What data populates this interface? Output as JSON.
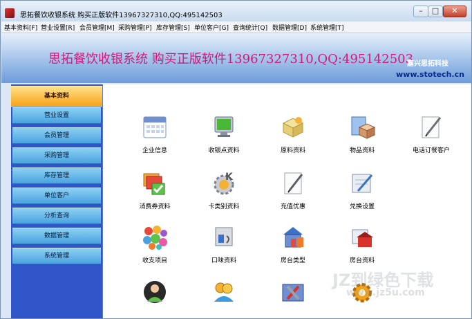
{
  "window": {
    "title": "思拓餐饮收银系统  购买正版软件13967327310,QQ:495142503",
    "minimize": "–",
    "maximize": "□",
    "close": "✕"
  },
  "menu": [
    "基本资料[F]",
    "营业设置[R]",
    "会员管理[M]",
    "采购管理[P]",
    "库存管理[S]",
    "单位客户[G]",
    "查询统计[Q]",
    "数据管理[D]",
    "系统管理[T]"
  ],
  "banner": {
    "headline": "思拓餐饮收银系统   购买正版软件13967327310,QQ:495142503",
    "brand": "嘉兴思拓科技",
    "url": "www.stotech.cn"
  },
  "sidebar": {
    "items": [
      "基本资料",
      "营业设置",
      "会员管理",
      "采购管理",
      "库存管理",
      "单位客户",
      "分析查询",
      "数据管理",
      "系统管理"
    ],
    "active_index": 0
  },
  "tiles": [
    {
      "label": "企业信息",
      "icon": "calendar-icon"
    },
    {
      "label": "收银点资料",
      "icon": "monitor-icon"
    },
    {
      "label": "原料资料",
      "icon": "materials-icon"
    },
    {
      "label": "物品资料",
      "icon": "goods-box-icon"
    },
    {
      "label": "电话订餐客户",
      "icon": "pen-paper-icon"
    },
    {
      "label": "消费券资料",
      "icon": "coupon-check-icon"
    },
    {
      "label": "卡类别资料",
      "icon": "card-gear-icon"
    },
    {
      "label": "充值优惠",
      "icon": "recharge-pen-icon"
    },
    {
      "label": "兑换设置",
      "icon": "exchange-pen-icon"
    },
    {
      "label": "收支项目",
      "icon": "colorful-balls-icon"
    },
    {
      "label": "口味资料",
      "icon": "taste-icon"
    },
    {
      "label": "房台类型",
      "icon": "house-type-icon"
    },
    {
      "label": "房台资料",
      "icon": "house-info-icon"
    },
    {
      "label": "",
      "icon": "person-icon"
    },
    {
      "label": "",
      "icon": "users-icon"
    },
    {
      "label": "",
      "icon": "toolbox-icon"
    },
    {
      "label": "",
      "icon": "gears-icon"
    }
  ],
  "watermark": {
    "line1": "JZ到绿色下载",
    "line2": "www.jz5u.com"
  },
  "colors": {
    "banner_text": "#d4187a",
    "sidebar_bg": "#2f55c8",
    "active_item": "#f8a31a",
    "url": "#0a2a8f"
  }
}
